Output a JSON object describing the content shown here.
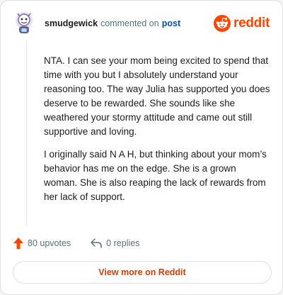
{
  "header": {
    "username": "smudgewick",
    "action_text": "commented on",
    "post_link": "post"
  },
  "logo": {
    "text": "reddit",
    "icon": "reddit-snoo-icon",
    "color": "#ff4500"
  },
  "comment": {
    "paragraphs": [
      "NTA. I can see your mom being excited to spend that time with you but I absolutely understand your reasoning too. The way Julia has supported you does deserve to be rewarded. She sounds like she weathered your stormy attitude and came out still supportive and loving.",
      "I originally said N A H, but thinking about your mom’s behavior has me on the edge. She is a grown woman. She is also reaping the lack of rewards from her lack of support."
    ]
  },
  "actions": {
    "upvotes": "80 upvotes",
    "upvote_icon": "upvote-arrow-icon",
    "replies": "0 replies",
    "reply_icon": "reply-arrow-icon"
  },
  "view_more": "View more on Reddit"
}
